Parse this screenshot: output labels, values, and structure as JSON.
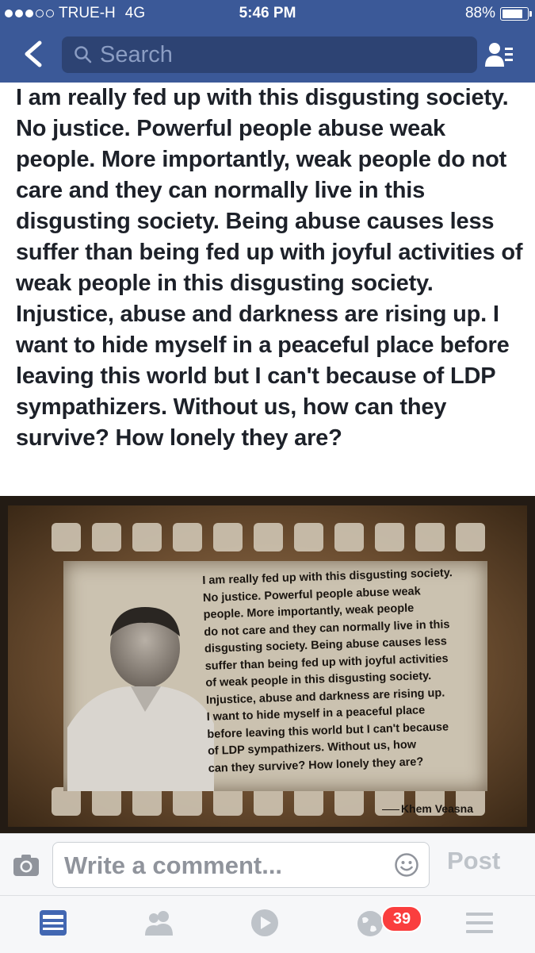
{
  "status_bar": {
    "carrier": "TRUE-H",
    "network": "4G",
    "time": "5:46 PM",
    "battery_percent": "88%",
    "battery_level": 0.88,
    "signal_bars_filled": 3,
    "signal_bars_total": 5
  },
  "nav": {
    "search_placeholder": "Search",
    "back_icon": "chevron-left-icon",
    "right_icon": "friend-requests-icon",
    "bar_color": "#3b5998"
  },
  "post": {
    "text": "I am really fed up with this disgusting society. No justice. Powerful people abuse weak people. More importantly, weak people do not care and they can normally live in this disgusting society. Being abuse causes less suffer than being fed up with joyful activities of weak people in this disgusting society. Injustice, abuse and darkness are rising up. I want to hide myself in a peaceful place before leaving this world but I can't because of LDP sympathizers. Without us, how can they survive? How lonely they are?",
    "image": {
      "quote_lines": [
        "I am really fed up with this disgusting society.",
        "No justice. Powerful people abuse weak",
        "people. More importantly, weak people",
        "do not care and they can normally live in this",
        "disgusting society. Being abuse causes less",
        "suffer than being fed up with joyful activities",
        "of weak people in this disgusting society.",
        "Injustice, abuse and darkness are rising up.",
        "I want to hide myself in a peaceful place",
        "before leaving this world but I can't because",
        "of LDP sympathizers. Without us, how",
        "can they survive? How lonely they are?"
      ],
      "signature": "Khem Veasna"
    }
  },
  "comment_bar": {
    "placeholder": "Write a comment...",
    "post_label": "Post"
  },
  "tab_bar": {
    "tabs": [
      {
        "icon": "news-feed-icon",
        "active": true
      },
      {
        "icon": "friends-icon",
        "active": false
      },
      {
        "icon": "video-icon",
        "active": false
      },
      {
        "icon": "notifications-globe-icon",
        "active": false
      },
      {
        "icon": "menu-icon",
        "active": false
      }
    ],
    "notification_badge": "39"
  },
  "colors": {
    "brand_blue": "#3b5998",
    "active_tab": "#4267b2",
    "inactive_tab": "#bec3c9",
    "badge_red": "#fa3e3e"
  }
}
